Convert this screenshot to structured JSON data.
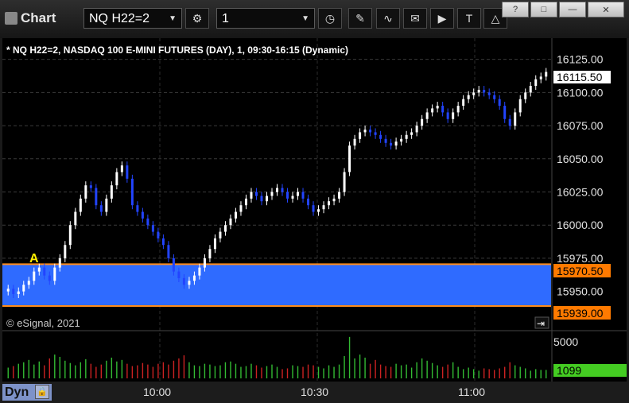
{
  "app": {
    "title": "Chart"
  },
  "toolbar": {
    "symbol": "NQ H22=2",
    "interval": "1"
  },
  "window_buttons": [
    "?",
    "□",
    "—",
    "✕"
  ],
  "chart_header": "* NQ H22=2, NASDAQ 100 E-MINI FUTURES (DAY), 1, 09:30-16:15 (Dynamic)",
  "watermark": "© eSignal, 2021",
  "annotation_label": "A",
  "colors": {
    "band": "#2f6bff",
    "band_border": "#ff8c1a",
    "bar_up": "#ffffff",
    "bar_down": "#2244ff",
    "volume_up": "#33bb33",
    "volume_down": "#cc2222",
    "last_price_bg": "#ffffff",
    "level_bg": "#ff7a00",
    "volume_badge_bg": "#44cc22"
  },
  "price_axis": {
    "ticks": [
      "16125.00",
      "16100.00",
      "16075.00",
      "16050.00",
      "16025.00",
      "16000.00",
      "15975.00",
      "15950.00"
    ],
    "last_price": "16115.50",
    "band_upper": "15970.50",
    "band_lower": "15939.00"
  },
  "volume_axis": {
    "tick": "5000",
    "current": "1099"
  },
  "time_axis": {
    "mode": "Dyn",
    "ticks": [
      "10:00",
      "10:30",
      "11:00"
    ]
  },
  "chart_data": {
    "type": "bar",
    "title": "* NQ H22=2, NASDAQ 100 E-MINI FUTURES (DAY), 1, 09:30-16:15 (Dynamic)",
    "x_ticks": [
      "10:00",
      "10:30",
      "11:00"
    ],
    "ylim": [
      15930,
      16135
    ],
    "grid": true,
    "band": {
      "upper": 15970.5,
      "lower": 15939
    },
    "close": [
      15952,
      15948,
      15950,
      15955,
      15958,
      15965,
      15968,
      15962,
      15958,
      15968,
      15975,
      15985,
      16000,
      16010,
      16020,
      16030,
      16028,
      16015,
      16010,
      16020,
      16030,
      16040,
      16045,
      16035,
      16015,
      16010,
      16005,
      16000,
      15995,
      15990,
      15985,
      15975,
      15965,
      15960,
      15955,
      15958,
      15962,
      15968,
      15975,
      15982,
      15990,
      15995,
      16000,
      16005,
      16010,
      16015,
      16020,
      16025,
      16022,
      16018,
      16022,
      16025,
      16028,
      16025,
      16020,
      16022,
      16025,
      16020,
      16015,
      16010,
      16012,
      16015,
      16018,
      16020,
      16025,
      16040,
      16060,
      16065,
      16070,
      16072,
      16070,
      16068,
      16065,
      16062,
      16060,
      16063,
      16065,
      16068,
      16070,
      16075,
      16080,
      16085,
      16088,
      16090,
      16085,
      16080,
      16085,
      16090,
      16095,
      16098,
      16100,
      16102,
      16100,
      16098,
      16095,
      16090,
      16080,
      16075,
      16085,
      16095,
      16100,
      16105,
      16110,
      16112,
      16115.5
    ],
    "volume": [
      1400,
      1600,
      1900,
      2100,
      2400,
      1800,
      2200,
      1700,
      2600,
      3100,
      2800,
      2300,
      2000,
      1700,
      2100,
      2500,
      1900,
      1500,
      1800,
      2300,
      2700,
      2200,
      2400,
      1900,
      1600,
      1700,
      2000,
      1800,
      1500,
      1900,
      2100,
      1800,
      2300,
      2600,
      3000,
      2100,
      1700,
      1600,
      1900,
      1800,
      1600,
      1700,
      2100,
      2200,
      1900,
      1500,
      1600,
      1900,
      1700,
      1400,
      1600,
      1800,
      1500,
      1200,
      1300,
      1700,
      1600,
      1500,
      1800,
      1700,
      1500,
      1300,
      1700,
      1500,
      1800,
      2900,
      5400,
      2600,
      3100,
      2700,
      1900,
      2400,
      1800,
      1600,
      1500,
      1900,
      1700,
      1800,
      1400,
      2100,
      2600,
      2300,
      2000,
      1700,
      1500,
      1800,
      2100,
      1500,
      1200,
      1400,
      1200,
      1000,
      1300,
      1200,
      1100,
      1300,
      1500,
      2100,
      1700,
      1500,
      1300,
      1000,
      1200,
      1100,
      1099
    ]
  }
}
